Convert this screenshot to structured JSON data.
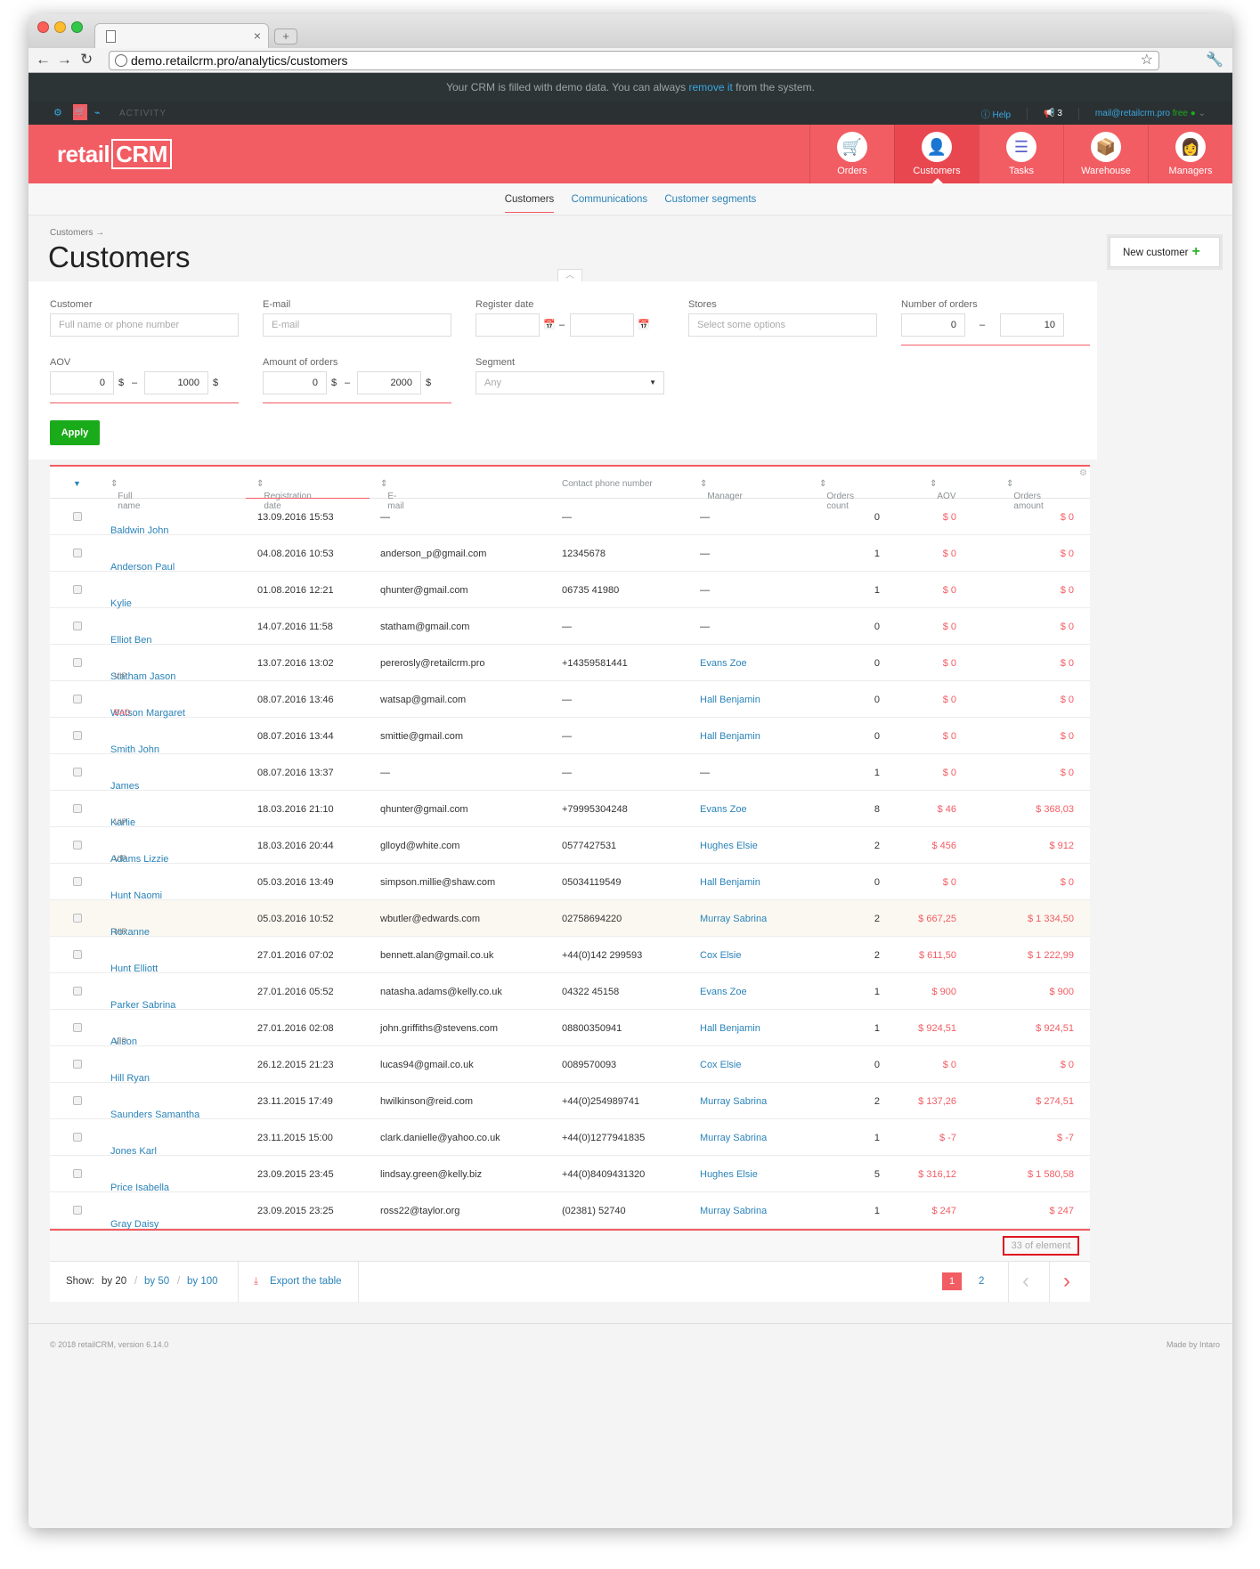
{
  "browser": {
    "url": "demo.retailcrm.pro/analytics/customers"
  },
  "banner": {
    "prefix": "Your CRM is filled with demo data. You can always ",
    "link": "remove it",
    "suffix": " from the system."
  },
  "topbar": {
    "activity": "ACTIVITY",
    "help": "Help",
    "notifications": "3",
    "account": "mail@retailcrm.pro",
    "plan": "free"
  },
  "header": {
    "logo": "retail",
    "logo_crm": "CRM",
    "modules": [
      {
        "label": "Orders",
        "icon": "cart-icon",
        "color": "#2ea6e0"
      },
      {
        "label": "Customers",
        "icon": "customer-icon",
        "color": "#e9474f"
      },
      {
        "label": "Tasks",
        "icon": "tasks-icon",
        "color": "#5b5fc7"
      },
      {
        "label": "Warehouse",
        "icon": "box-icon",
        "color": "#f5b82e"
      },
      {
        "label": "Managers",
        "icon": "manager-icon",
        "color": "#2c6fbf"
      }
    ]
  },
  "subnav": {
    "items": [
      "Customers",
      "Communications",
      "Customer segments"
    ]
  },
  "page": {
    "breadcrumb": "Customers →",
    "title": "Customers",
    "new_button": "New customer",
    "plus": "+"
  },
  "filters": {
    "customer_label": "Customer",
    "customer_placeholder": "Full name or phone number",
    "email_label": "E-mail",
    "email_placeholder": "E-mail",
    "register_label": "Register date",
    "stores_label": "Stores",
    "stores_placeholder": "Select some options",
    "orders_num_label": "Number of orders",
    "orders_num_from": "0",
    "orders_num_to": "10",
    "aov_label": "AOV",
    "aov_from": "0",
    "aov_to": "1000",
    "amount_label": "Amount of orders",
    "amount_from": "0",
    "amount_to": "2000",
    "segment_label": "Segment",
    "segment_value": "Any",
    "currency": "$",
    "dash": "–",
    "apply": "Apply"
  },
  "table": {
    "columns": [
      "Full name",
      "Registration date",
      "E-mail",
      "Contact phone number",
      "Manager",
      "Orders count",
      "AOV",
      "Orders amount"
    ],
    "rows": [
      {
        "name": "Baldwin John",
        "tag": "",
        "date": "13.09.2016 15:53",
        "email": "—",
        "phone": "—",
        "manager": "—",
        "count": "0",
        "aov": "$ 0",
        "amount": "$ 0"
      },
      {
        "name": "Anderson Paul",
        "tag": "",
        "date": "04.08.2016 10:53",
        "email": "anderson_p@gmail.com",
        "phone": "12345678",
        "manager": "—",
        "count": "1",
        "aov": "$ 0",
        "amount": "$ 0"
      },
      {
        "name": "Kylie",
        "tag": "",
        "date": "01.08.2016 12:21",
        "email": "qhunter@gmail.com",
        "phone": "06735 41980",
        "manager": "—",
        "count": "1",
        "aov": "$ 0",
        "amount": "$ 0"
      },
      {
        "name": "Elliot Ben",
        "tag": "",
        "date": "14.07.2016 11:58",
        "email": "statham@gmail.com",
        "phone": "—",
        "manager": "—",
        "count": "0",
        "aov": "$ 0",
        "amount": "$ 0"
      },
      {
        "name": "Statham Jason",
        "tag": "VIP",
        "date": "13.07.2016 13:02",
        "email": "pererosly@retailcrm.pro",
        "phone": "+14359581441",
        "manager": "Evans Zoe",
        "count": "0",
        "aov": "$ 0",
        "amount": "$ 0"
      },
      {
        "name": "Watson Margaret",
        "tag": "BAD",
        "date": "08.07.2016 13:46",
        "email": "watsap@gmail.com",
        "phone": "—",
        "manager": "Hall Benjamin",
        "count": "0",
        "aov": "$ 0",
        "amount": "$ 0"
      },
      {
        "name": "Smith John",
        "tag": "",
        "date": "08.07.2016 13:44",
        "email": "smittie@gmail.com",
        "phone": "—",
        "manager": "Hall Benjamin",
        "count": "0",
        "aov": "$ 0",
        "amount": "$ 0"
      },
      {
        "name": "James",
        "tag": "",
        "date": "08.07.2016 13:37",
        "email": "—",
        "phone": "—",
        "manager": "—",
        "count": "1",
        "aov": "$ 0",
        "amount": "$ 0"
      },
      {
        "name": "Karlie",
        "tag": "VIP",
        "date": "18.03.2016 21:10",
        "email": "qhunter@gmail.com",
        "phone": "+79995304248",
        "manager": "Evans Zoe",
        "count": "8",
        "aov": "$ 46",
        "amount": "$ 368,03"
      },
      {
        "name": "Adams Lizzie",
        "tag": "VIP",
        "date": "18.03.2016 20:44",
        "email": "glloyd@white.com",
        "phone": "0577427531",
        "manager": "Hughes Elsie",
        "count": "2",
        "aov": "$ 456",
        "amount": "$ 912"
      },
      {
        "name": "Hunt Naomi",
        "tag": "",
        "date": "05.03.2016 13:49",
        "email": "simpson.millie@shaw.com",
        "phone": "05034119549",
        "manager": "Hall Benjamin",
        "count": "0",
        "aov": "$ 0",
        "amount": "$ 0"
      },
      {
        "name": "Roxanne",
        "tag": "VIP",
        "date": "05.03.2016 10:52",
        "email": "wbutler@edwards.com",
        "phone": "02758694220",
        "manager": "Murray Sabrina",
        "count": "2",
        "aov": "$ 667,25",
        "amount": "$ 1 334,50"
      },
      {
        "name": "Hunt Elliott",
        "tag": "",
        "date": "27.01.2016 07:02",
        "email": "bennett.alan@gmail.co.uk",
        "phone": "+44(0)142 299593",
        "manager": "Cox Elsie",
        "count": "2",
        "aov": "$ 611,50",
        "amount": "$ 1 222,99"
      },
      {
        "name": "Parker Sabrina",
        "tag": "",
        "date": "27.01.2016 05:52",
        "email": "natasha.adams@kelly.co.uk",
        "phone": "04322 45158",
        "manager": "Evans Zoe",
        "count": "1",
        "aov": "$ 900",
        "amount": "$ 900"
      },
      {
        "name": "Alison",
        "tag": "VIP",
        "date": "27.01.2016 02:08",
        "email": "john.griffiths@stevens.com",
        "phone": "08800350941",
        "manager": "Hall Benjamin",
        "count": "1",
        "aov": "$ 924,51",
        "amount": "$ 924,51"
      },
      {
        "name": "Hill Ryan",
        "tag": "",
        "date": "26.12.2015 21:23",
        "email": "lucas94@gmail.co.uk",
        "phone": "0089570093",
        "manager": "Cox Elsie",
        "count": "0",
        "aov": "$ 0",
        "amount": "$ 0"
      },
      {
        "name": "Saunders Samantha",
        "tag": "",
        "date": "23.11.2015 17:49",
        "email": "hwilkinson@reid.com",
        "phone": "+44(0)254989741",
        "manager": "Murray Sabrina",
        "count": "2",
        "aov": "$ 137,26",
        "amount": "$ 274,51"
      },
      {
        "name": "Jones Karl",
        "tag": "",
        "date": "23.11.2015 15:00",
        "email": "clark.danielle@yahoo.co.uk",
        "phone": "+44(0)1277941835",
        "manager": "Murray Sabrina",
        "count": "1",
        "aov": "$ -7",
        "amount": "$ -7"
      },
      {
        "name": "Price Isabella",
        "tag": "",
        "date": "23.09.2015 23:45",
        "email": "lindsay.green@kelly.biz",
        "phone": "+44(0)8409431320",
        "manager": "Hughes Elsie",
        "count": "5",
        "aov": "$ 316,12",
        "amount": "$ 1 580,58"
      },
      {
        "name": "Gray Daisy",
        "tag": "",
        "date": "23.09.2015 23:25",
        "email": "ross22@taylor.org",
        "phone": "(02381) 52740",
        "manager": "Murray Sabrina",
        "count": "1",
        "aov": "$ 247",
        "amount": "$ 247"
      }
    ],
    "total": "33  of element"
  },
  "pager": {
    "show": "Show:",
    "by20": "by 20",
    "by50": "by 50",
    "by100": "by 100",
    "slash": "/",
    "export": "Export the table",
    "page1": "1",
    "page2": "2"
  },
  "footer": {
    "left": "© 2018 retailCRM, version 6.14.0",
    "right": "Made by Intaro"
  }
}
